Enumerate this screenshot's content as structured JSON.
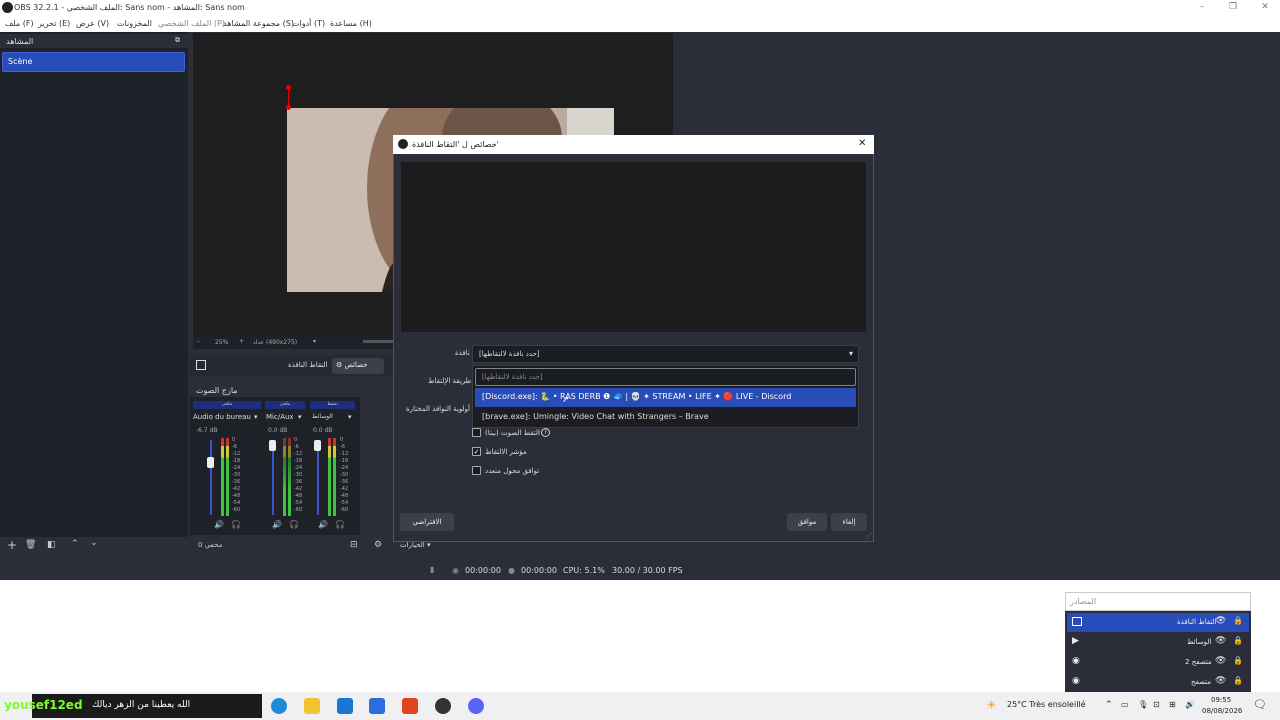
{
  "window": {
    "title": "OBS 32.2.1 - الملف الشخصي: Sans nom - المشاهد: Sans nom"
  },
  "menu": [
    "ملف (F)",
    "تحرير (E)",
    "عرض (V)",
    "المخزونات",
    "الملف الشخصي (P)",
    "مجموعة المشاهد (S)",
    "أدوات (T)",
    "مساعدة (H)"
  ],
  "scenes": {
    "header": "المشاهد",
    "items": [
      "Scène"
    ]
  },
  "preview": {
    "zoom": "25%",
    "resolution": "عداد (490x275)"
  },
  "context_bar": {
    "source_name": "التقاط النافذة",
    "properties_button": "خصائص"
  },
  "mixer": {
    "header": "مازج الصوت",
    "channels": [
      {
        "tag": "ملغى",
        "name": "Audio du bureau",
        "level": "-6.7 dB"
      },
      {
        "tag": "ملغى",
        "name": "Mic/Aux",
        "level": "0.0 dB"
      },
      {
        "tag": "نشط",
        "name": "الوسائط",
        "level": "0.0 dB"
      }
    ],
    "scale": [
      "0",
      "-6",
      "-12",
      "-18",
      "-24",
      "-30",
      "-36",
      "-42",
      "-48",
      "-54",
      "-60"
    ]
  },
  "transitions": {
    "label": "مخفي 0",
    "options_label": "الخيارات"
  },
  "status": {
    "live_time": "00:00:00",
    "rec_time": "00:00:00",
    "cpu": "CPU: 5.1%",
    "fps": "30.00 / 30.00 FPS"
  },
  "dialog": {
    "title": "خصائص ل 'التقاط النافذة'",
    "window_label": "نافذة",
    "window_value": "[حدد نافذة لالتقاطها]",
    "method_label": "طريقة الإلتقاط",
    "priority_label": "أولوية النوافذ المختارة",
    "search_placeholder": "[حدد نافذة لالتقاطها]",
    "options": [
      "[Discord.exe]: 🐍 • RAS DERB ❶ 🧢 | 💀 ✦ STREAM • LIFE ✦ 🔴 LIVE - Discord",
      "[brave.exe]: Umingle: Video Chat with Strangers – Brave"
    ],
    "checkboxes": [
      {
        "label": "التقط الصوت (بيتا)",
        "checked": false
      },
      {
        "label": "مؤشر الالتقاط",
        "checked": true
      },
      {
        "label": "توافق محول متعدد",
        "checked": false
      }
    ],
    "defaults_button": "الافتراضي",
    "ok_button": "موافق",
    "cancel_button": "إلغاء"
  },
  "sources": {
    "placeholder": "المصادر",
    "items": [
      "التقاط النافذة",
      "الوسائط",
      "متصفح 2",
      "متصفح"
    ]
  },
  "taskbar": {
    "watermark": "yousef12ed",
    "subtitle": "الله يعطينا من الزهر ديالك",
    "weather": "25°C  Très ensoleillé",
    "time": "09:55",
    "date": "08/08/2026"
  },
  "colors": {
    "accent": "#284cb8",
    "panel": "#2b2e38",
    "dark": "#1f2128",
    "meter_green": "#3fc23f"
  }
}
